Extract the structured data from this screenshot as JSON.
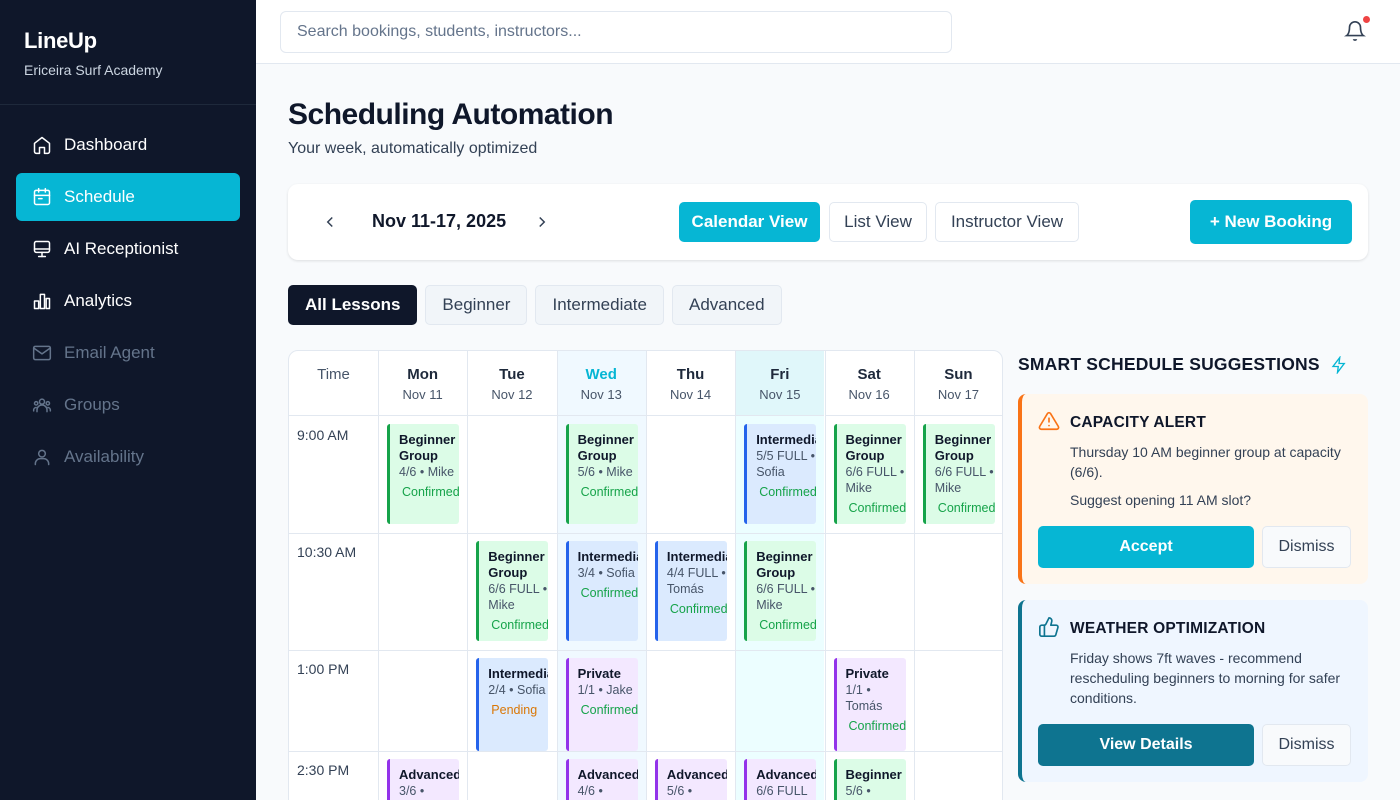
{
  "brand": {
    "name": "LineUp",
    "subtitle": "Ericeira Surf Academy"
  },
  "nav": [
    {
      "label": "Dashboard",
      "icon": "home-icon",
      "state": "normal"
    },
    {
      "label": "Schedule",
      "icon": "calendar-icon",
      "state": "active"
    },
    {
      "label": "AI Receptionist",
      "icon": "monitor-icon",
      "state": "normal"
    },
    {
      "label": "Analytics",
      "icon": "bar-chart-icon",
      "state": "normal"
    },
    {
      "label": "Email Agent",
      "icon": "mail-icon",
      "state": "dim"
    },
    {
      "label": "Groups",
      "icon": "users-icon",
      "state": "dim"
    },
    {
      "label": "Availability",
      "icon": "user-icon",
      "state": "dim"
    }
  ],
  "topbar": {
    "search_placeholder": "Search bookings, students, instructors..."
  },
  "page": {
    "title": "Scheduling Automation",
    "subtitle": "Your week, automatically optimized"
  },
  "toolbar": {
    "range": "Nov 11-17, 2025",
    "views": [
      "Calendar View",
      "List View",
      "Instructor View"
    ],
    "active_view": "Calendar View",
    "new_booking": "+ New Booking"
  },
  "filters": {
    "items": [
      "All Lessons",
      "Beginner",
      "Intermediate",
      "Advanced"
    ],
    "active": "All Lessons"
  },
  "calendar": {
    "time_header": "Time",
    "days": [
      {
        "name": "Mon",
        "date": "Nov 11"
      },
      {
        "name": "Tue",
        "date": "Nov 12"
      },
      {
        "name": "Wed",
        "date": "Nov 13",
        "today": true
      },
      {
        "name": "Thu",
        "date": "Nov 14"
      },
      {
        "name": "Fri",
        "date": "Nov 15",
        "highlight": true
      },
      {
        "name": "Sat",
        "date": "Nov 16"
      },
      {
        "name": "Sun",
        "date": "Nov 17"
      }
    ],
    "times": [
      "9:00 AM",
      "10:30 AM",
      "1:00 PM",
      "2:30 PM"
    ],
    "lessons": [
      {
        "day": 0,
        "slot": 0,
        "title": "Beginner Group",
        "meta": "4/6 • Mike",
        "status": "Confirmed",
        "color": "green"
      },
      {
        "day": 2,
        "slot": 0,
        "title": "Beginner Group",
        "meta": "5/6 • Mike",
        "status": "Confirmed",
        "color": "green"
      },
      {
        "day": 4,
        "slot": 0,
        "title": "Intermediate",
        "meta": "5/5 FULL • Sofia",
        "status": "Confirmed",
        "color": "blue"
      },
      {
        "day": 5,
        "slot": 0,
        "title": "Beginner Group",
        "meta": "6/6 FULL • Mike",
        "status": "Confirmed",
        "color": "green"
      },
      {
        "day": 6,
        "slot": 0,
        "title": "Beginner Group",
        "meta": "6/6 FULL • Mike",
        "status": "Confirmed",
        "color": "green"
      },
      {
        "day": 1,
        "slot": 1,
        "title": "Beginner Group",
        "meta": "6/6 FULL • Mike",
        "status": "Confirmed",
        "color": "green"
      },
      {
        "day": 2,
        "slot": 1,
        "title": "Intermediate",
        "meta": "3/4 • Sofia",
        "status": "Confirmed",
        "color": "blue"
      },
      {
        "day": 3,
        "slot": 1,
        "title": "Intermediate",
        "meta": "4/4 FULL • Tomás",
        "status": "Confirmed",
        "color": "blue"
      },
      {
        "day": 4,
        "slot": 1,
        "title": "Beginner Group",
        "meta": "6/6 FULL • Mike",
        "status": "Confirmed",
        "color": "green"
      },
      {
        "day": 1,
        "slot": 2,
        "title": "Intermediate",
        "meta": "2/4 • Sofia",
        "status": "Pending",
        "color": "blue"
      },
      {
        "day": 2,
        "slot": 2,
        "title": "Private",
        "meta": "1/1 • Jake",
        "status": "Confirmed",
        "color": "purple"
      },
      {
        "day": 5,
        "slot": 2,
        "title": "Private",
        "meta": "1/1 • Tomás",
        "status": "Confirmed",
        "color": "purple"
      },
      {
        "day": 0,
        "slot": 3,
        "title": "Advanced",
        "meta": "3/6 •",
        "status": "",
        "color": "purple"
      },
      {
        "day": 2,
        "slot": 3,
        "title": "Advanced",
        "meta": "4/6 •",
        "status": "",
        "color": "purple"
      },
      {
        "day": 3,
        "slot": 3,
        "title": "Advanced",
        "meta": "5/6 •",
        "status": "",
        "color": "purple"
      },
      {
        "day": 4,
        "slot": 3,
        "title": "Advanced",
        "meta": "6/6 FULL",
        "status": "",
        "color": "purple"
      },
      {
        "day": 5,
        "slot": 3,
        "title": "Beginner",
        "meta": "5/6 •",
        "status": "",
        "color": "green"
      }
    ]
  },
  "suggestions": {
    "title": "SMART SCHEDULE SUGGESTIONS",
    "alert": {
      "title": "CAPACITY ALERT",
      "text1": "Thursday 10 AM beginner group at capacity (6/6).",
      "text2": "Suggest opening 11 AM slot?",
      "primary": "Accept",
      "dismiss": "Dismiss"
    },
    "weather": {
      "title": "WEATHER OPTIMIZATION",
      "text": "Friday shows 7ft waves - recommend rescheduling beginners to morning for safer conditions.",
      "primary": "View Details",
      "dismiss": "Dismiss"
    }
  },
  "colors": {
    "accent": "#06b6d4",
    "sidebar": "#0f172a",
    "confirmed": "#16a34a",
    "pending": "#d97706"
  }
}
